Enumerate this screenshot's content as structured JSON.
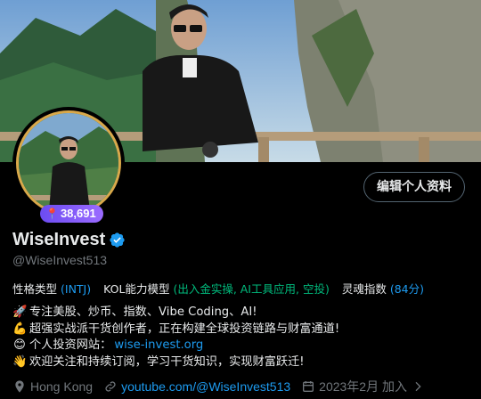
{
  "profile": {
    "name": "WiseInvest",
    "handle": "@WiseInvest513",
    "edit_label": "编辑个人资料",
    "kol_count": "38,691"
  },
  "traits": [
    {
      "label": "性格类型",
      "value": "(INTJ)"
    },
    {
      "label": "KOL能力模型",
      "value": "(出入金实操, AI工具应用, 空投)"
    },
    {
      "label": "灵魂指数",
      "value": "(84分)"
    }
  ],
  "bio": {
    "line1": "专注美股、炒币、指数、Vibe Coding、AI!",
    "line2": "超强实战派干货创作者，正在构建全球投资链路与财富通道!",
    "line3_prefix": "个人投资网站：",
    "line3_link": "wise-invest.org",
    "line4": "欢迎关注和持续订阅，学习干货知识，实现财富跃迁!"
  },
  "meta": {
    "location": "Hong Kong",
    "website": "youtube.com/@WiseInvest513",
    "joined": "2023年2月 加入"
  },
  "colors": {
    "accent": "#1d9bf0",
    "verified": "#1d9bf0",
    "badge": "#7b5af5"
  },
  "icons": [
    "rocket-icon",
    "flexed-biceps-icon",
    "smile-icon",
    "waving-hand-icon",
    "location-icon",
    "link-icon",
    "calendar-icon",
    "chevron-right-icon",
    "verified-icon"
  ]
}
